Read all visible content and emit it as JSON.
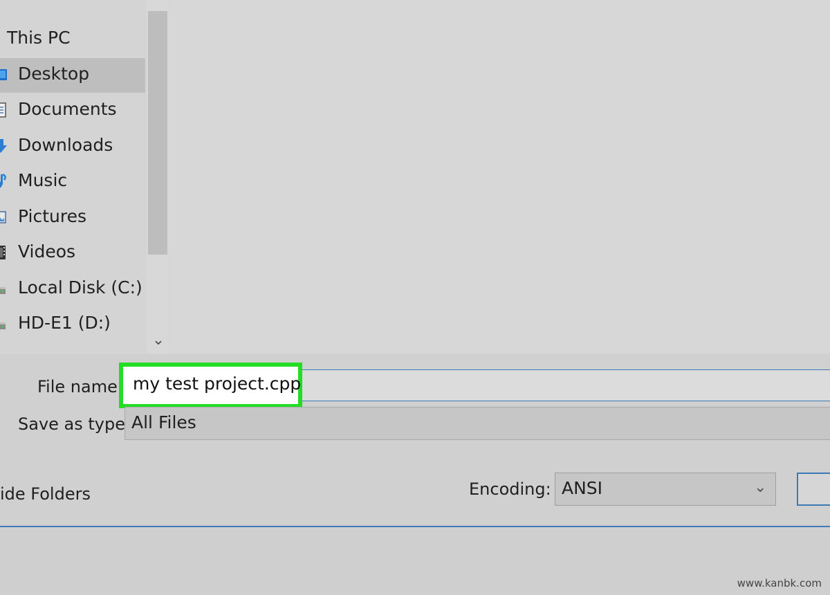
{
  "nav": {
    "root_label": "This PC",
    "items": [
      {
        "label": "Desktop",
        "icon": "desktop-icon",
        "selected": true
      },
      {
        "label": "Documents",
        "icon": "documents-icon"
      },
      {
        "label": "Downloads",
        "icon": "downloads-icon"
      },
      {
        "label": "Music",
        "icon": "music-icon"
      },
      {
        "label": "Pictures",
        "icon": "pictures-icon"
      },
      {
        "label": "Videos",
        "icon": "videos-icon"
      },
      {
        "label": "Local Disk (C:)",
        "icon": "drive-icon"
      },
      {
        "label": "HD-E1 (D:)",
        "icon": "drive-icon"
      }
    ]
  },
  "form": {
    "file_name_label": "File name:",
    "file_name_value": "my test project.cpp",
    "save_as_type_label": "Save as type:",
    "save_as_type_value": "All Files",
    "hide_folders_label": "ide Folders",
    "encoding_label": "Encoding:",
    "encoding_value": "ANSI"
  },
  "colors": {
    "highlight": "#22dd22",
    "focus_border": "#3d79b8"
  },
  "watermark": "www.kanbk.com"
}
